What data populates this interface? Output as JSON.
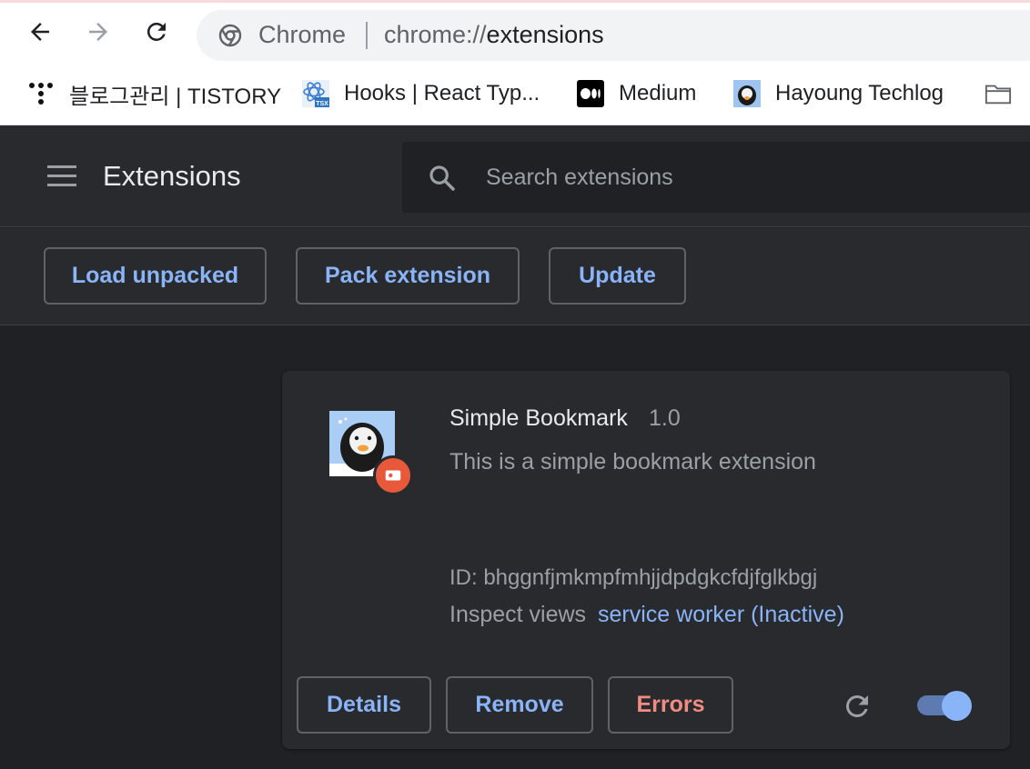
{
  "browser": {
    "omnibox": {
      "site_label": "Chrome",
      "url_scheme": "chrome://",
      "url_path": "extensions"
    }
  },
  "bookmarks": [
    {
      "label": "블로그관리 | TISTORY",
      "icon": "tistory-icon"
    },
    {
      "label": "Hooks | React Typ...",
      "icon": "react-tsx-icon"
    },
    {
      "label": "Medium",
      "icon": "medium-icon"
    },
    {
      "label": "Hayoung Techlog",
      "icon": "penguin-avatar-icon"
    },
    {
      "label": "",
      "icon": "folder-icon"
    }
  ],
  "header": {
    "title": "Extensions",
    "search_placeholder": "Search extensions"
  },
  "developer_bar": {
    "load_unpacked": "Load unpacked",
    "pack_extension": "Pack extension",
    "update": "Update"
  },
  "extension": {
    "name": "Simple Bookmark",
    "version": "1.0",
    "description": "This is a simple bookmark extension",
    "id_text": "ID: bhggnfjmkmpfmhjjdpdgkcfdjfglkbgj",
    "inspect_label": "Inspect views",
    "inspect_link": "service worker (Inactive)",
    "details_label": "Details",
    "remove_label": "Remove",
    "errors_label": "Errors",
    "enabled": true
  },
  "colors": {
    "accent": "#8ab4f8",
    "error": "#f28b82",
    "badge": "#e8593b",
    "page_bg": "#202124",
    "surface": "#292a2d"
  }
}
